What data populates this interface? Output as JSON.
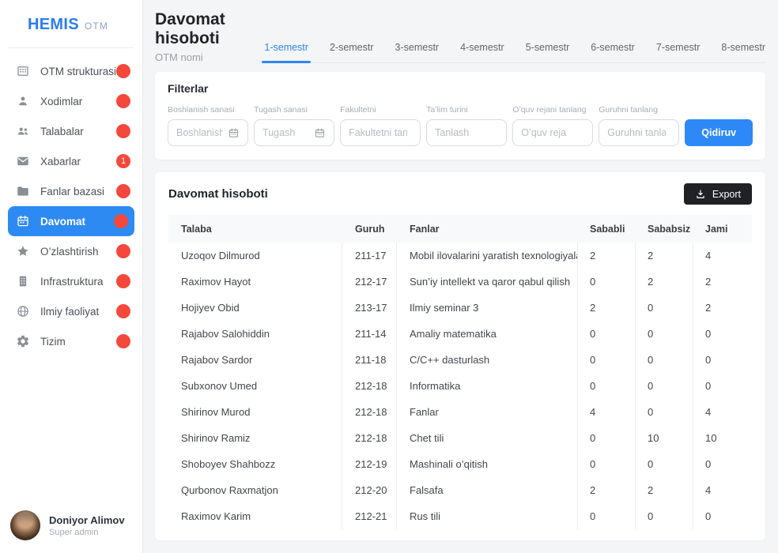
{
  "colors": {
    "accent": "#2E89F6",
    "badge": "#F5483C",
    "export_bg": "#1F2124",
    "active_tab": "#2F86F4"
  },
  "sidebar": {
    "logo": {
      "brand": "HEMIS",
      "suffix": "OTM"
    },
    "items": [
      {
        "label": "OTM strukturasi",
        "icon": "building-icon",
        "active": false
      },
      {
        "label": "Xodimlar",
        "icon": "person-icon",
        "active": false
      },
      {
        "label": "Talabalar",
        "icon": "people-icon",
        "active": false
      },
      {
        "label": "Xabarlar",
        "icon": "mail-icon",
        "active": false,
        "badge": "1"
      },
      {
        "label": "Fanlar bazasi",
        "icon": "folder-icon",
        "active": false
      },
      {
        "label": "Davomat",
        "icon": "calendar-icon",
        "active": true
      },
      {
        "label": "O’zlashtirish",
        "icon": "star-icon",
        "active": false
      },
      {
        "label": "Infrastruktura",
        "icon": "tower-building-icon",
        "active": false
      },
      {
        "label": "Ilmiy faoliyat",
        "icon": "globe-icon",
        "active": false
      },
      {
        "label": "Tizim",
        "icon": "gear-icon",
        "active": false
      }
    ],
    "user": {
      "name": "Doniyor Alimov",
      "role": "Super admin"
    }
  },
  "header": {
    "title": "Davomat hisoboti",
    "subtitle": "OTM nomi",
    "tabs": [
      {
        "label": "1-semestr",
        "active": true
      },
      {
        "label": "2-semestr",
        "active": false
      },
      {
        "label": "3-semestr",
        "active": false
      },
      {
        "label": "4-semestr",
        "active": false
      },
      {
        "label": "5-semestr",
        "active": false
      },
      {
        "label": "6-semestr",
        "active": false
      },
      {
        "label": "7-semestr",
        "active": false
      },
      {
        "label": "8-semestr",
        "active": false
      }
    ]
  },
  "filters": {
    "title": "Filterlar",
    "fields": [
      {
        "id": "start-date",
        "label": "Boshlanish sanasi",
        "placeholder": "Boshlanish",
        "calendar": true
      },
      {
        "id": "end-date",
        "label": "Tugash sanasi",
        "placeholder": "Tugash",
        "calendar": true
      },
      {
        "id": "faculty",
        "label": "Fakultetni",
        "placeholder": "Fakultetni tanlang",
        "calendar": false
      },
      {
        "id": "education-type",
        "label": "Ta’lim turini",
        "placeholder": "Tanlash",
        "calendar": false
      },
      {
        "id": "curriculum",
        "label": "O’quv rejani tanlang",
        "placeholder": "O’quv reja",
        "calendar": false
      },
      {
        "id": "group",
        "label": "Guruhni tanlang",
        "placeholder": "Guruhni tanlang",
        "calendar": false
      }
    ],
    "search_label": "Qidiruv"
  },
  "report": {
    "title": "Davomat hisoboti",
    "export_label": "Export",
    "columns": [
      "Talaba",
      "Guruh",
      "Fanlar",
      "Sababli",
      "Sababsiz",
      "Jami"
    ],
    "rows": [
      {
        "talaba": "Uzoqov Dilmurod",
        "guruh": "211-17",
        "fanlar": "Mobil ilovalarini yaratish texnologiyalari",
        "sababli": "2",
        "sababsiz": "2",
        "jami": "4"
      },
      {
        "talaba": "Raximov Hayot",
        "guruh": "212-17",
        "fanlar": "Sun’iy intellekt va qaror qabul qilish",
        "sababli": "0",
        "sababsiz": "2",
        "jami": "2"
      },
      {
        "talaba": "Hojiyev Obid",
        "guruh": "213-17",
        "fanlar": "Ilmiy seminar 3",
        "sababli": "2",
        "sababsiz": "0",
        "jami": "2"
      },
      {
        "talaba": "Rajabov Salohiddin",
        "guruh": "211-14",
        "fanlar": "Amaliy matematika",
        "sababli": "0",
        "sababsiz": "0",
        "jami": "0"
      },
      {
        "talaba": "Rajabov Sardor",
        "guruh": "211-18",
        "fanlar": "C/C++ dasturlash",
        "sababli": "0",
        "sababsiz": "0",
        "jami": "0"
      },
      {
        "talaba": "Subxonov Umed",
        "guruh": "212-18",
        "fanlar": "Informatika",
        "sababli": "0",
        "sababsiz": "0",
        "jami": "0"
      },
      {
        "talaba": "Shirinov Murod",
        "guruh": "212-18",
        "fanlar": "Fanlar",
        "sababli": "4",
        "sababsiz": "0",
        "jami": "4"
      },
      {
        "talaba": "Shirinov Ramiz",
        "guruh": "212-18",
        "fanlar": "Chet tili",
        "sababli": "0",
        "sababsiz": "10",
        "jami": "10"
      },
      {
        "talaba": "Shoboyev Shahbozz",
        "guruh": "212-19",
        "fanlar": "Mashinali o’qitish",
        "sababli": "0",
        "sababsiz": "0",
        "jami": "0"
      },
      {
        "talaba": "Qurbonov Raxmatjon",
        "guruh": "212-20",
        "fanlar": "Falsafa",
        "sababli": "2",
        "sababsiz": "2",
        "jami": "4"
      },
      {
        "talaba": "Raximov Karim",
        "guruh": "212-21",
        "fanlar": "Rus tili",
        "sababli": "0",
        "sababsiz": "0",
        "jami": "0"
      }
    ]
  }
}
